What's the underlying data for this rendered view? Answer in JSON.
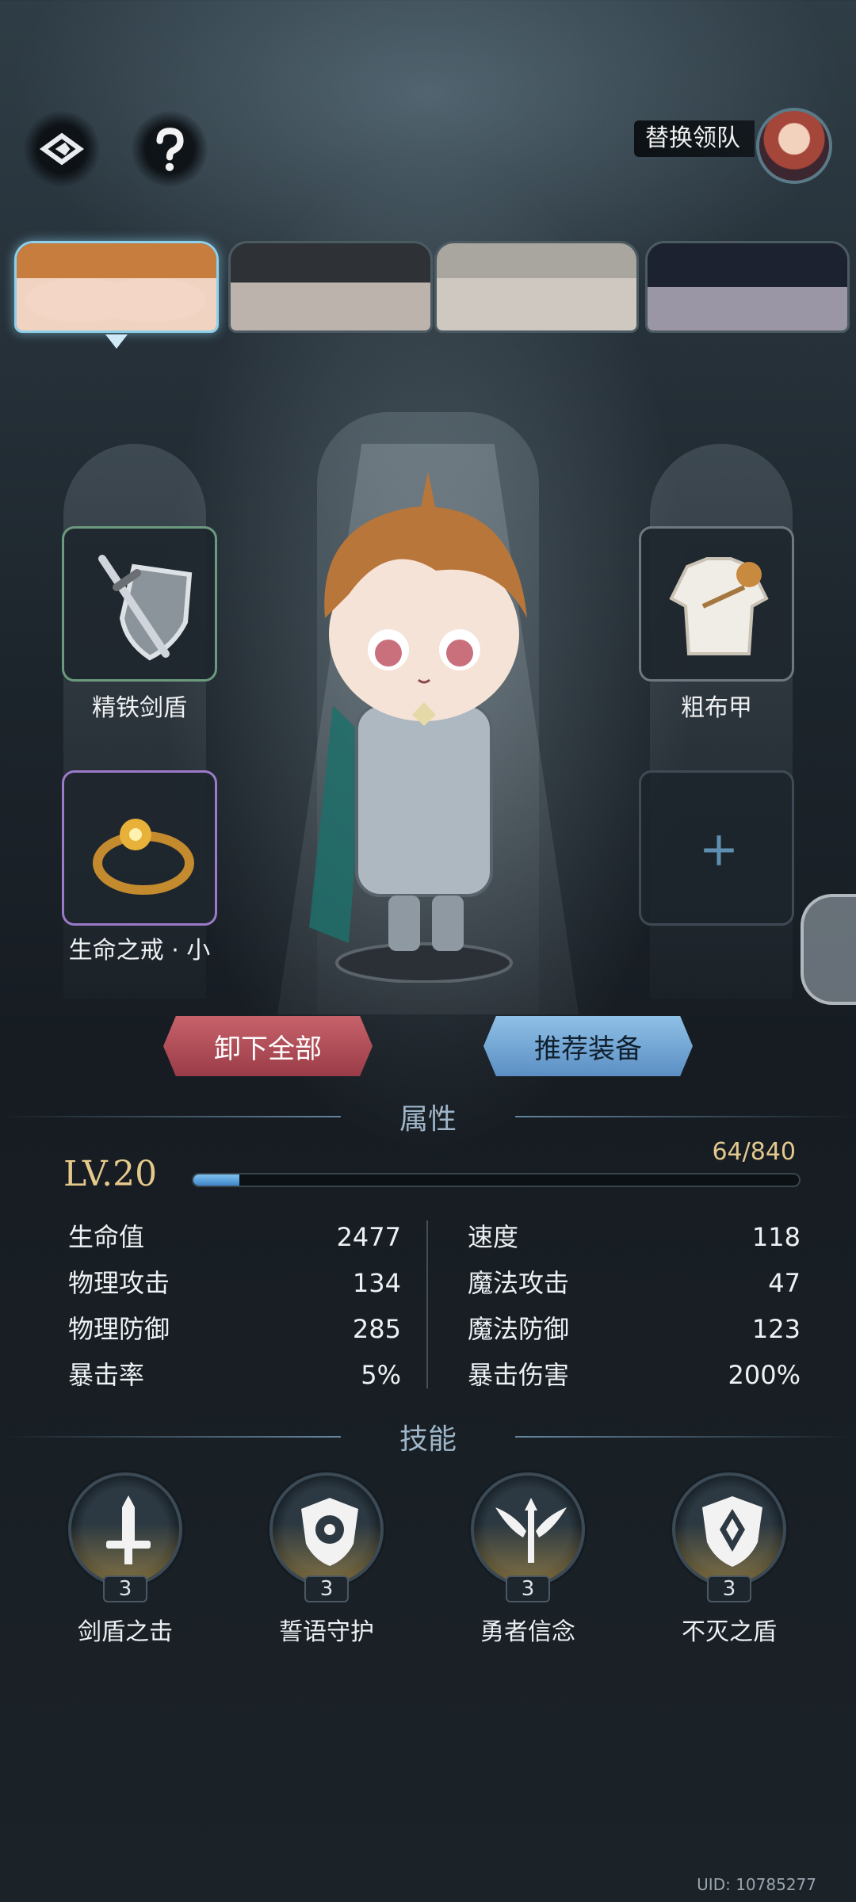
{
  "top_bar": {
    "back_icon": "back-icon",
    "help_icon": "question-icon",
    "switch_leader_label": "替换领队"
  },
  "hero_tabs": [
    {
      "name": "hero-1",
      "active": true
    },
    {
      "name": "hero-2",
      "active": false
    },
    {
      "name": "hero-3",
      "active": false
    },
    {
      "name": "hero-4",
      "active": false
    }
  ],
  "equipment": {
    "weapon": {
      "label": "精铁剑盾",
      "icon": "sword-shield-icon"
    },
    "armor": {
      "label": "粗布甲",
      "icon": "cloth-armor-icon"
    },
    "accessory": {
      "label": "生命之戒 · 小",
      "icon": "ring-icon"
    },
    "empty_slot": {
      "icon": "plus-icon"
    }
  },
  "actions": {
    "unequip_all": "卸下全部",
    "recommend": "推荐装备"
  },
  "attributes": {
    "section_title": "属性",
    "level_label": "LV.20",
    "xp_text": "64/840",
    "xp_progress": 0.076,
    "left": [
      {
        "label": "生命值",
        "value": "2477"
      },
      {
        "label": "物理攻击",
        "value": "134"
      },
      {
        "label": "物理防御",
        "value": "285"
      },
      {
        "label": "暴击率",
        "value": "5%"
      }
    ],
    "right": [
      {
        "label": "速度",
        "value": "118"
      },
      {
        "label": "魔法攻击",
        "value": "47"
      },
      {
        "label": "魔法防御",
        "value": "123"
      },
      {
        "label": "暴击伤害",
        "value": "200%"
      }
    ]
  },
  "skills": {
    "section_title": "技能",
    "items": [
      {
        "name": "剑盾之击",
        "level": "3",
        "icon": "sword-icon"
      },
      {
        "name": "誓语守护",
        "level": "3",
        "icon": "target-shield-icon"
      },
      {
        "name": "勇者信念",
        "level": "3",
        "icon": "trident-wings-icon"
      },
      {
        "name": "不灭之盾",
        "level": "3",
        "icon": "shield-icon"
      }
    ]
  },
  "uid": "UID: 10785277",
  "colors": {
    "accent_blue": "#8fc0e6",
    "accent_red": "#c7626a",
    "gold": "#e6c98a"
  }
}
